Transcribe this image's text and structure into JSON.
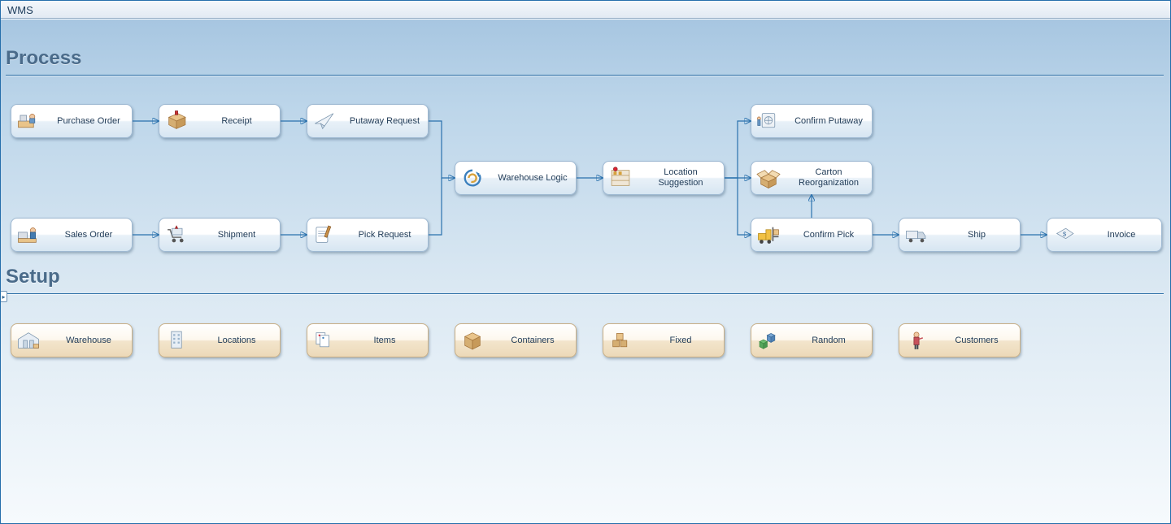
{
  "app": {
    "title": "WMS"
  },
  "sections": {
    "process": {
      "heading": "Process"
    },
    "setup": {
      "heading": "Setup"
    }
  },
  "process": {
    "purchase_order": {
      "label": "Purchase Order",
      "icon": "desk-icon"
    },
    "receipt": {
      "label": "Receipt",
      "icon": "receipt-icon"
    },
    "putaway_request": {
      "label": "Putaway Request",
      "icon": "paper-plane-icon"
    },
    "sales_order": {
      "label": "Sales Order",
      "icon": "worker-pc-icon"
    },
    "shipment": {
      "label": "Shipment",
      "icon": "cart-icon"
    },
    "pick_request": {
      "label": "Pick Request",
      "icon": "clipboard-pen-icon"
    },
    "warehouse_logic": {
      "label": "Warehouse Logic",
      "icon": "cycle-arrows-icon"
    },
    "location_suggestion": {
      "label": "Location Suggestion",
      "icon": "shelves-icon"
    },
    "confirm_putaway": {
      "label": "Confirm Putaway",
      "icon": "vault-icon"
    },
    "carton_reorg": {
      "label": "Carton Reorganization",
      "icon": "open-box-icon"
    },
    "confirm_pick": {
      "label": "Confirm Pick",
      "icon": "forklift-icon"
    },
    "ship": {
      "label": "Ship",
      "icon": "truck-icon"
    },
    "invoice": {
      "label": "Invoice",
      "icon": "invoice-tag-icon"
    }
  },
  "setup": {
    "warehouse": {
      "label": "Warehouse",
      "icon": "warehouse-building-icon"
    },
    "locations": {
      "label": "Locations",
      "icon": "office-building-icon"
    },
    "items": {
      "label": "Items",
      "icon": "item-tags-icon"
    },
    "containers": {
      "label": "Containers",
      "icon": "carton-icon"
    },
    "fixed": {
      "label": "Fixed",
      "icon": "stacked-boxes-icon"
    },
    "random": {
      "label": "Random",
      "icon": "random-cubes-icon"
    },
    "customers": {
      "label": "Customers",
      "icon": "customer-person-icon"
    }
  },
  "colors": {
    "connector": "#2a71ad",
    "process_tile_border": "#9fb9d2",
    "setup_tile_border": "#c7ae86",
    "heading_text": "#4a6b8a"
  }
}
